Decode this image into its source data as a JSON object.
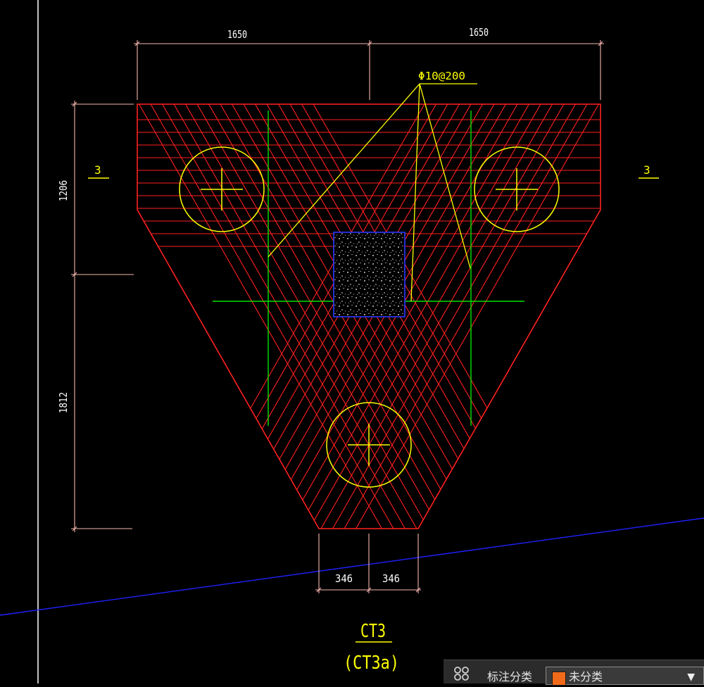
{
  "drawing": {
    "dim_top_left": "1650",
    "dim_top_right": "1650",
    "dim_left_upper": "1206",
    "dim_left_lower": "1812",
    "dim_bottom_left": "346",
    "dim_bottom_right": "346",
    "section_mark_left": "3",
    "section_mark_right": "3",
    "rebar_note": "Φ10@200",
    "cap_label": "CT3",
    "cap_label_alt": "(CT3a)"
  },
  "panel": {
    "icon": "grid-icon",
    "category_label": "标注分类",
    "category_value": "未分类",
    "swatch_color": "#f06a1a"
  },
  "colors": {
    "background": "#000000",
    "outline": "#ff2020",
    "dimension": "#f6b7b0",
    "annotation": "#ffff00",
    "axis": "#00e000",
    "column": "#2a3aff",
    "crosshair_line": "#ffffff",
    "background_line": "#2020ff"
  }
}
